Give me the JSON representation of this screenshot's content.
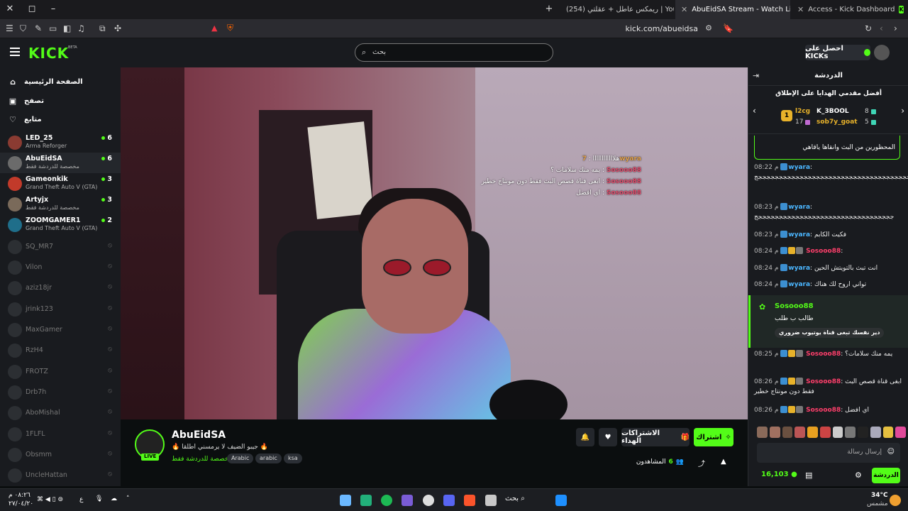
{
  "browser": {
    "tabs": [
      {
        "title": "(254) ريمكس عاطل + عقلتي | YouTube",
        "active": false
      },
      {
        "title": "AbuEidSA Stream - Watch Live",
        "active": true
      },
      {
        "title": "Access - Kick Dashboard",
        "active": false
      }
    ],
    "url": "kick.com/abueidsa"
  },
  "header": {
    "logo": "KICK",
    "beta": "BETA",
    "search_placeholder": "بحث",
    "get_kicks": "احصل على KICKs"
  },
  "sidebar": {
    "nav": [
      {
        "label": "الصفحة الرئيسية",
        "icon": "home-icon"
      },
      {
        "label": "تصفح",
        "icon": "browse-icon"
      },
      {
        "label": "متابع",
        "icon": "heart-icon"
      }
    ],
    "channels": [
      {
        "name": "LED_25",
        "game": "Arma Reforger",
        "viewers": "6",
        "live": true
      },
      {
        "name": "AbuEidSA",
        "game": "مخصصة للدردشة فقط",
        "viewers": "6",
        "live": true
      },
      {
        "name": "Gameonkik",
        "game": "Grand Theft Auto V (GTA)",
        "viewers": "3",
        "live": true
      },
      {
        "name": "Artyjx",
        "game": "مخصصة للدردشة فقط",
        "viewers": "3",
        "live": true
      },
      {
        "name": "ZOOMGAMER1",
        "game": "Grand Theft Auto V (GTA)",
        "viewers": "2",
        "live": true
      },
      {
        "name": "SQ_MR7",
        "live": false
      },
      {
        "name": "Vilon",
        "live": false
      },
      {
        "name": "aziz18jr",
        "live": false
      },
      {
        "name": "jrink123",
        "live": false
      },
      {
        "name": "MaxGamer",
        "live": false
      },
      {
        "name": "RzH4",
        "live": false
      },
      {
        "name": "FROTZ",
        "live": false
      },
      {
        "name": "Drb7h",
        "live": false
      },
      {
        "name": "AboMishal",
        "live": false
      },
      {
        "name": "1FLFL",
        "live": false
      },
      {
        "name": "Obsmm",
        "live": false
      },
      {
        "name": "UncleHattan",
        "live": false
      }
    ]
  },
  "video_overlay": [
    {
      "user": "7wyara",
      "text": "هلاااااااااااا"
    },
    {
      "user": "Sosooo88",
      "text": "يمه منك سلامات ؟"
    },
    {
      "user": "Sosooo88",
      "text": "ابغى قناة قصص البث فقط دون مونتاج خطير"
    },
    {
      "user": "Sosooo88",
      "text": "اي افضل"
    }
  ],
  "stream": {
    "name": "AbuEidSA",
    "live": "LIVE",
    "title": "🔥 جيبو الضيف لا يرمسني اطلقا 🔥",
    "category": "مخصصة للدردشة فقط",
    "tags": [
      "Arabic",
      "arabic",
      "ksa"
    ],
    "follow": "اشتراك",
    "subscriptions": "الاشتراكات الهداء",
    "viewers_label": "المشاهدون",
    "viewers": "6"
  },
  "chat": {
    "title": "الدردشة",
    "gifters_title": "أفضل مقدمي الهدايا على الإطلاق",
    "gifters": [
      {
        "name": "l2cg",
        "count": "17"
      },
      {
        "name": "K_3BOOL",
        "count": "8"
      },
      {
        "name": "sob7y_goat",
        "count": "5"
      }
    ],
    "gold_rank": "1",
    "pinned": "المحظورين من البث وانقاها ياقاهي",
    "messages": [
      {
        "time": "08:22 م",
        "user": "wyara",
        "text": "جججججججججججججججججججججججججججججججججججججججججججججججج",
        "color": "blue"
      },
      {
        "time": "08:23 م",
        "user": "wyara",
        "text": "جججججججججججججججججججججججججججججججججج",
        "color": "blue"
      },
      {
        "time": "08:23 م",
        "user": "wyara",
        "text": "فكيت الكابم",
        "color": "blue"
      },
      {
        "time": "08:24 م",
        "user": "Sosooo88",
        "text": "",
        "color": "red"
      },
      {
        "time": "08:24 م",
        "user": "wyara",
        "text": "انت تبث بالتويتش الحين",
        "color": "blue"
      },
      {
        "time": "08:24 م",
        "user": "wyara",
        "text": "تواني اروح لك هناك",
        "color": "blue"
      },
      {
        "time": "08:25 م",
        "user": "Sosooo88",
        "text": "يمه منك سلامات؟",
        "color": "red"
      },
      {
        "time": "08:26 م",
        "user": "Sosooo88",
        "text": "ابغى قناة قصص البث فقط دون مونتاج خطير",
        "color": "red"
      },
      {
        "time": "08:26 م",
        "user": "Sosooo88",
        "text": "اي افضل",
        "color": "red"
      }
    ],
    "highlight": {
      "user": "Sosooo88",
      "line1": "طالب ب طلب",
      "line2": "دير نفسك تبغى قناة يوتيوب ضروري"
    },
    "input_placeholder": "إرسال رسالة",
    "kicks": "16,103",
    "send": "الدردشة"
  },
  "taskbar": {
    "search": "بحث",
    "time": "٠٨:٢٦ م",
    "date": "٢٧/٠٤/٢٠",
    "lang": "ع",
    "weather": "34°C",
    "weather_desc": "مشمس"
  }
}
